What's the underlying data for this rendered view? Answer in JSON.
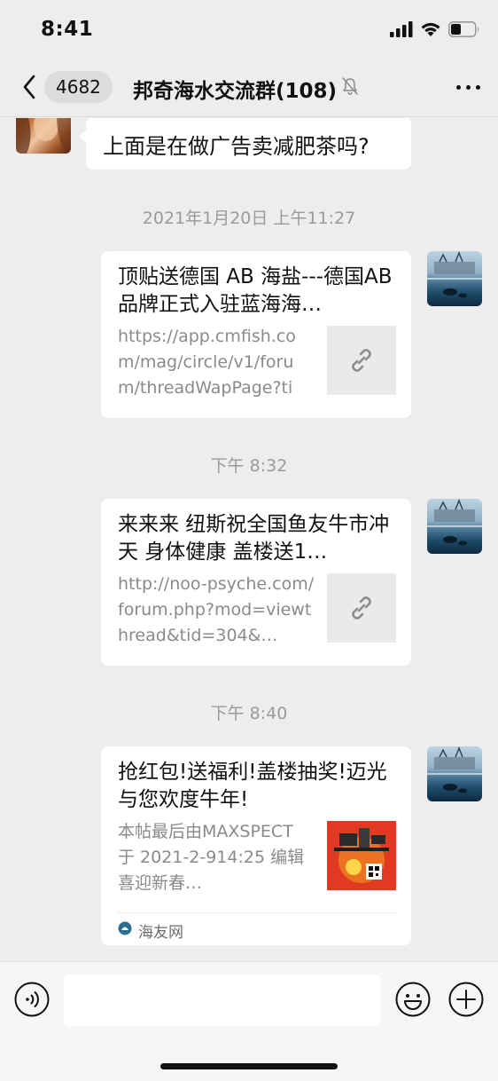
{
  "status_bar": {
    "time": "8:41"
  },
  "nav": {
    "back_count": "4682",
    "title": "邦奇海水交流群(108)"
  },
  "messages": [
    {
      "type": "text",
      "side": "left",
      "text": "上面是在做广告卖减肥茶吗?"
    },
    {
      "type": "timestamp",
      "text": "2021年1月20日 上午11:27"
    },
    {
      "type": "link",
      "side": "right",
      "title": "顶贴送德国 AB 海盐---德国AB品牌正式入驻蓝海海…",
      "desc": "https://app.cmfish.com/mag/circle/v1/forum/threadWapPage?tid…",
      "thumb_icon": "link-icon"
    },
    {
      "type": "timestamp",
      "text": "下午 8:32"
    },
    {
      "type": "link",
      "side": "right",
      "title": "来来来 纽斯祝全国鱼友牛市冲天 身体健康 盖楼送1…",
      "desc": "http://noo-psyche.com/forum.php?mod=viewthread&tid=304&…",
      "thumb_icon": "link-icon"
    },
    {
      "type": "timestamp",
      "text": "下午 8:40"
    },
    {
      "type": "link",
      "side": "right",
      "title": "抢红包!送福利!盖楼抽奖!迈光与您欢度牛年!",
      "desc": "本帖最后由MAXSPECT 于 2021-2-914:25 编辑喜迎新春…",
      "thumb_icon": "promo-image",
      "source": "海友网"
    }
  ],
  "colors": {
    "background": "#ededed",
    "bubble": "#ffffff",
    "timestamp": "#9a9a9a",
    "link_desc": "#8a8a8a"
  }
}
